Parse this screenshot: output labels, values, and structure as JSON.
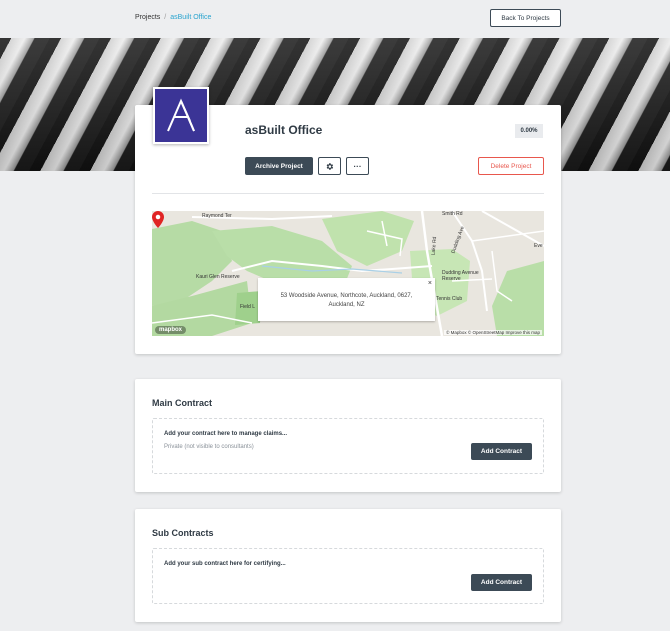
{
  "breadcrumb": {
    "projects": "Projects",
    "separator": "/",
    "current": "asBuilt Office"
  },
  "header": {
    "back_label": "Back To Projects"
  },
  "project": {
    "title": "asBuilt Office",
    "progress": "0.00%",
    "archive_label": "Archive Project",
    "settings_icon": "gear-icon",
    "more_label": "···",
    "delete_label": "Delete Project",
    "logo_color": "#3b3496"
  },
  "map": {
    "address_line1": "53 Woodside Avenue, Northcote, Auckland, 0627,",
    "address_line2": "Auckland, NZ",
    "close": "×",
    "attribution": "© Mapbox © OpenStreetMap  Improve this map",
    "mapbox_logo": "mapbox",
    "labels": {
      "raymond": "Raymond Ter",
      "kauri": "Kauri Glen Reserve",
      "dudding": "Dudding Avenue Reserve",
      "lake": "Lake Rd",
      "duddingave": "Dudding Ave",
      "tennis": "Tennis Club",
      "field": "Field L",
      "smith": "Smith Rd",
      "eve": "Eve"
    }
  },
  "main_contract": {
    "title": "Main Contract",
    "prompt": "Add your contract here to manage claims...",
    "privacy": "Private (not visible to consultants)",
    "add_label": "Add Contract"
  },
  "sub_contracts": {
    "title": "Sub Contracts",
    "prompt": "Add your sub contract here for certifying...",
    "add_label": "Add Contract"
  },
  "colors": {
    "accent": "#2aa4cf",
    "dark_button": "#3c4a56",
    "danger": "#e8574d",
    "background": "#edeef0"
  }
}
